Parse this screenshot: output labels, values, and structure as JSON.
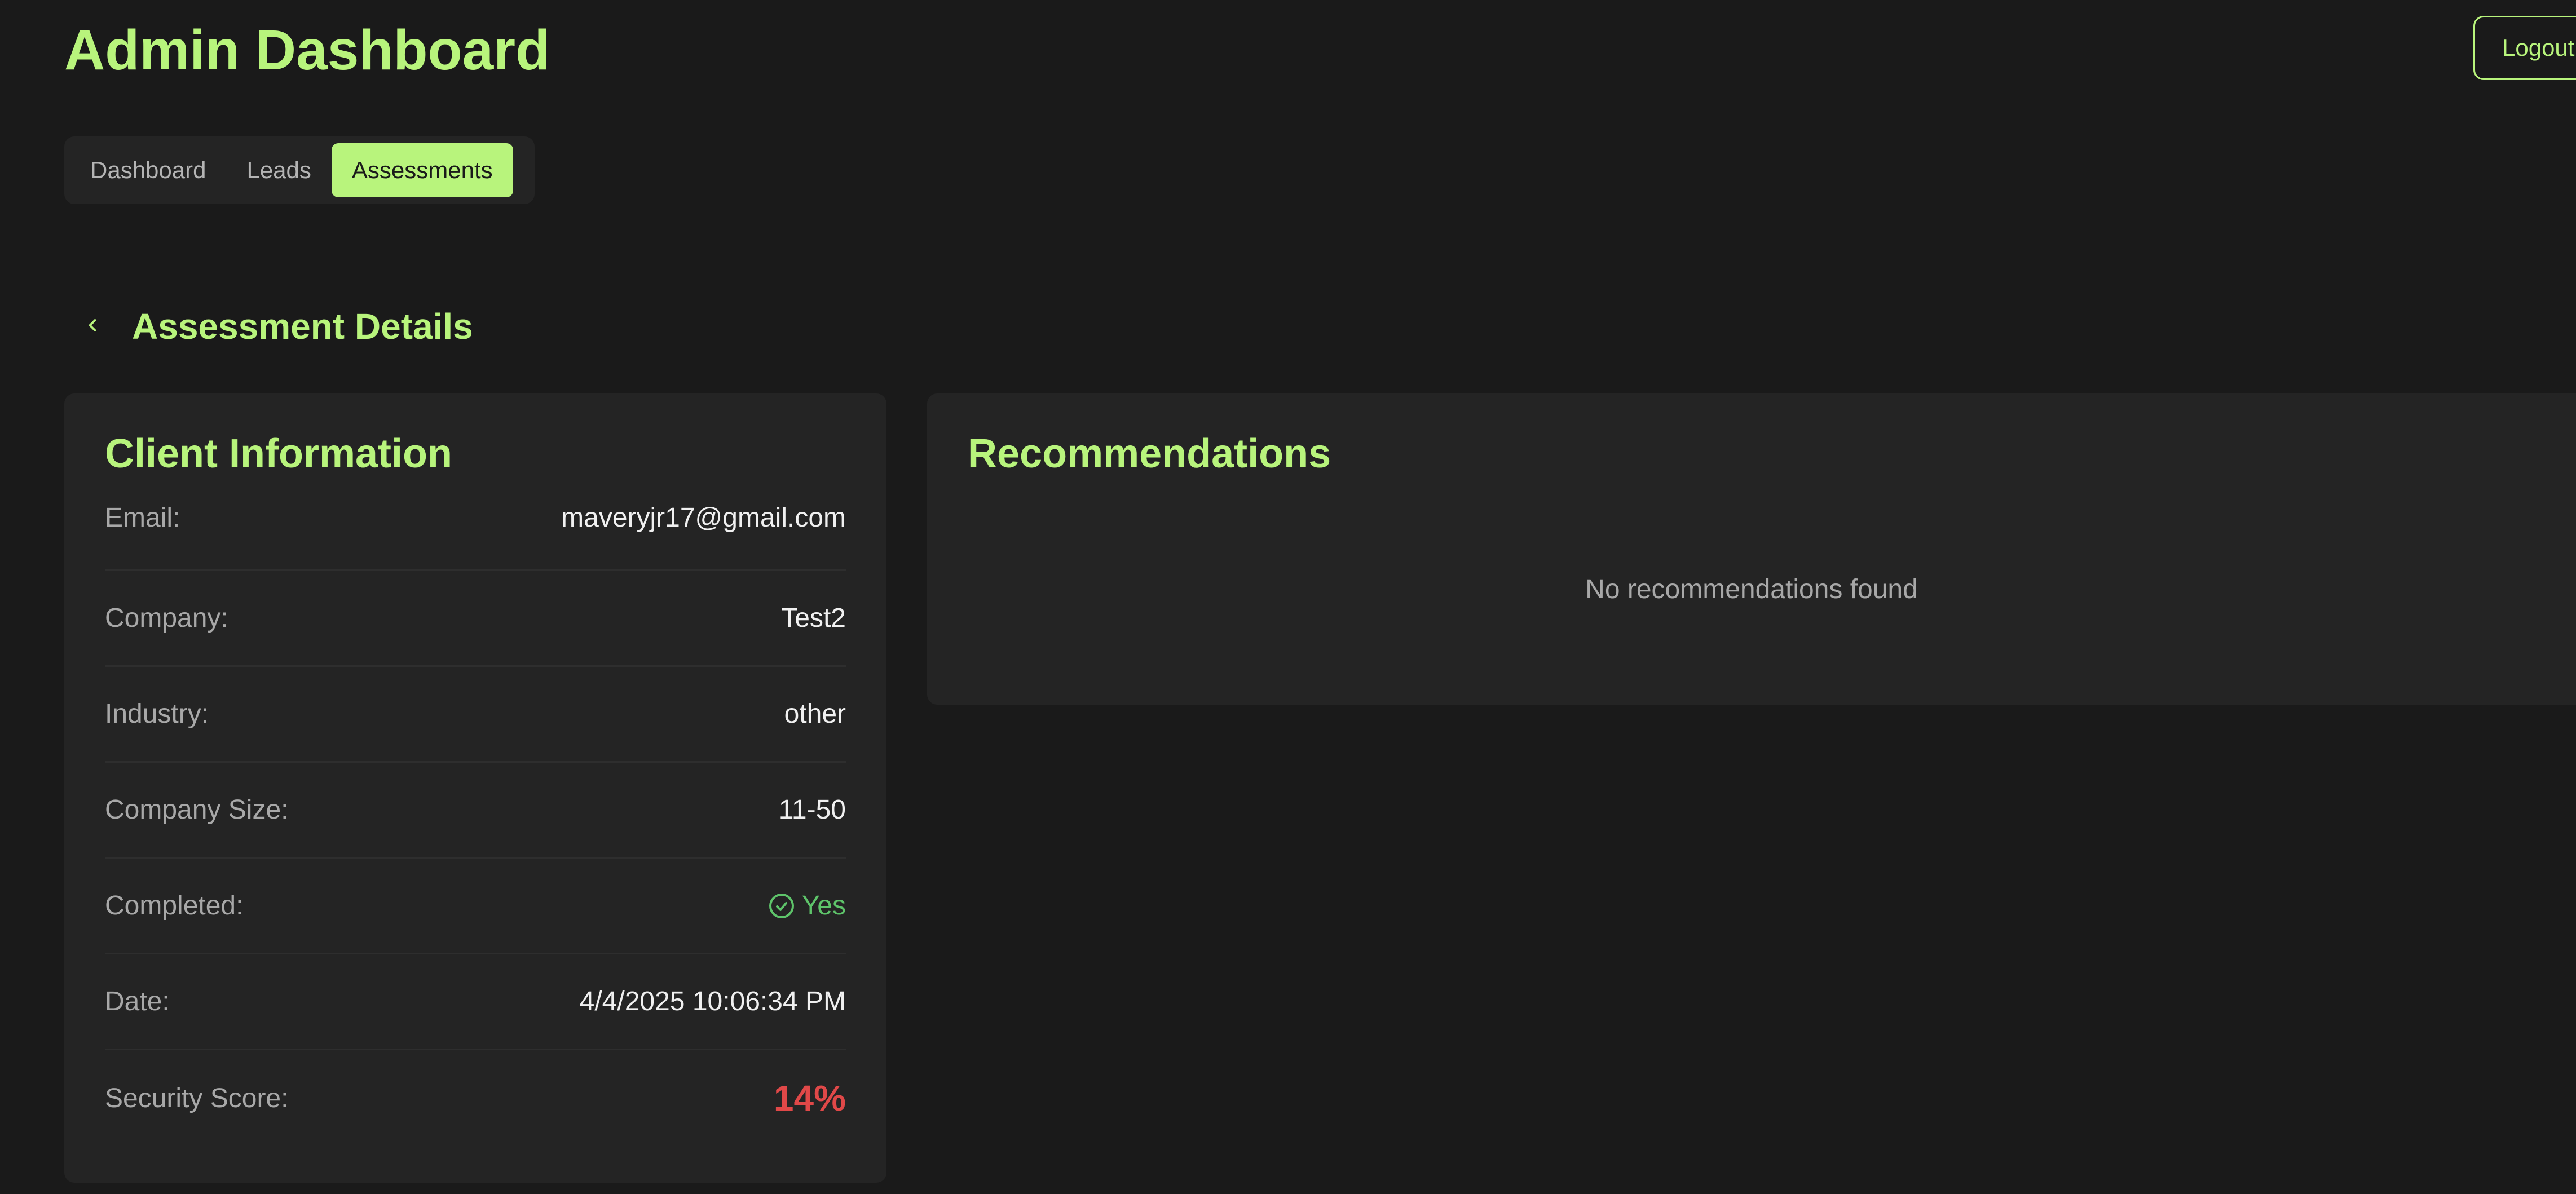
{
  "header": {
    "title": "Admin Dashboard",
    "logout_label": "Logout"
  },
  "tabs": [
    {
      "label": "Dashboard",
      "active": false
    },
    {
      "label": "Leads",
      "active": false
    },
    {
      "label": "Assessments",
      "active": true
    }
  ],
  "section": {
    "back_icon": "chevron-left-icon",
    "title": "Assessment Details"
  },
  "client_info": {
    "title": "Client Information",
    "rows": [
      {
        "label": "Email:",
        "value": "maveryjr17@gmail.com"
      },
      {
        "label": "Company:",
        "value": "Test2"
      },
      {
        "label": "Industry:",
        "value": "other"
      },
      {
        "label": "Company Size:",
        "value": "11-50"
      },
      {
        "label": "Completed:",
        "value": "Yes",
        "icon": "check-circle-icon"
      },
      {
        "label": "Date:",
        "value": "4/4/2025 10:06:34 PM"
      },
      {
        "label": "Security Score:",
        "value": "14%"
      }
    ]
  },
  "recommendations": {
    "title": "Recommendations",
    "empty_message": "No recommendations found"
  },
  "colors": {
    "background": "#1a1a1a",
    "card": "#242424",
    "accent": "#b8f47c",
    "success": "#5ec46a",
    "danger": "#e04848"
  }
}
